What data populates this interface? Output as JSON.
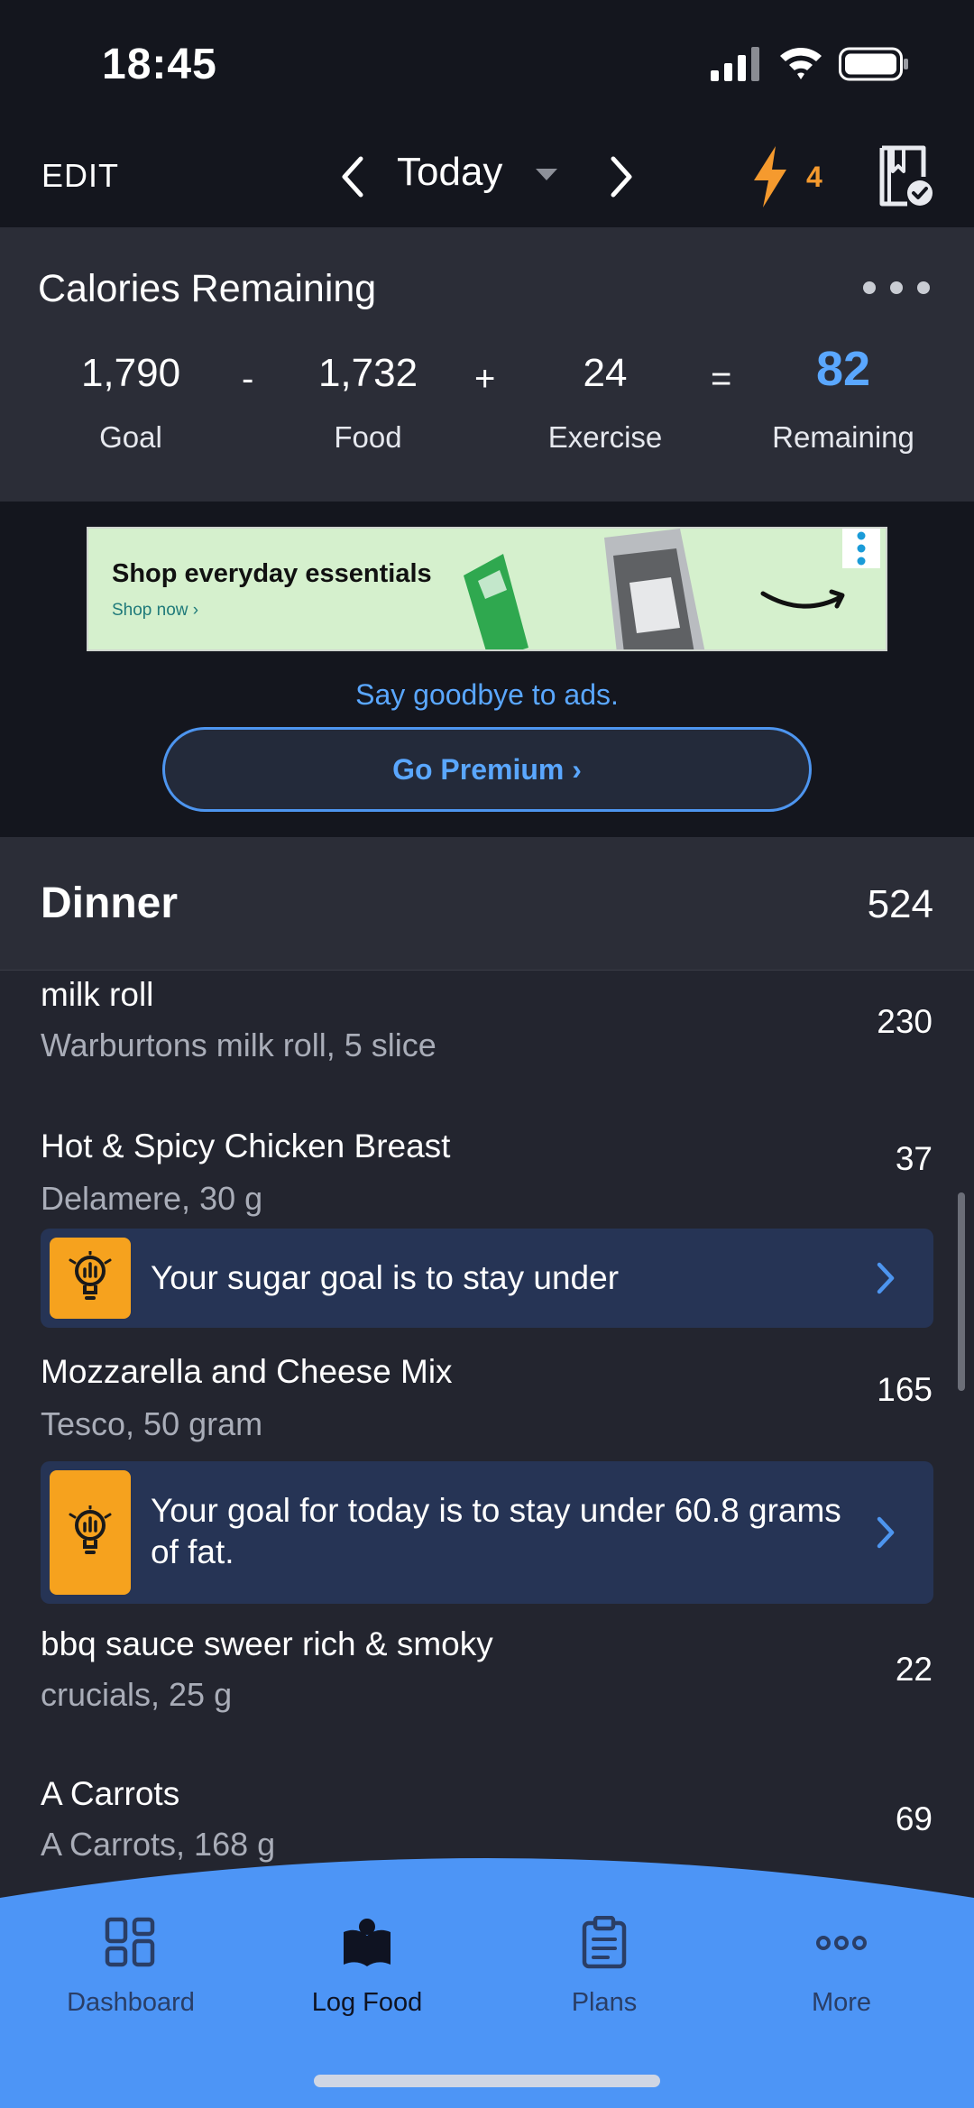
{
  "status_bar": {
    "time": "18:45",
    "icons": [
      "cellular-signal-icon",
      "wifi-icon",
      "battery-icon"
    ]
  },
  "top_nav": {
    "edit_label": "EDIT",
    "date_label": "Today",
    "streak_count": "4",
    "icons": [
      "chevron-left-icon",
      "caret-down-icon",
      "chevron-right-icon",
      "lightning-icon",
      "diary-complete-icon"
    ]
  },
  "calories": {
    "title": "Calories Remaining",
    "goal": {
      "value": "1,790",
      "label": "Goal"
    },
    "op_minus": "-",
    "food": {
      "value": "1,732",
      "label": "Food"
    },
    "op_plus": "+",
    "exercise": {
      "value": "24",
      "label": "Exercise"
    },
    "op_equals": "=",
    "remaining": {
      "value": "82",
      "label": "Remaining"
    }
  },
  "ad": {
    "title": "Shop everyday essentials",
    "cta": "Shop now ›",
    "goodbye_text": "Say goodbye to ads.",
    "premium_label": "Go Premium ›"
  },
  "meal": {
    "name": "Dinner",
    "calories": "524",
    "items": [
      {
        "name": "milk roll",
        "desc": "Warburtons milk roll, 5 slice",
        "cal": "230"
      },
      {
        "name": "Hot & Spicy Chicken Breast",
        "desc": "Delamere, 30 g",
        "cal": "37"
      },
      {
        "name": "Mozzarella and Cheese Mix",
        "desc": "Tesco, 50 gram",
        "cal": "165"
      },
      {
        "name": "bbq sauce sweer rich & smoky",
        "desc": "crucials, 25 g",
        "cal": "22"
      },
      {
        "name": "A Carrots",
        "desc": "A Carrots, 168 g",
        "cal": "69"
      }
    ],
    "tips": [
      {
        "text": "Your sugar goal is to stay under"
      },
      {
        "text": "Your goal for today is to stay under 60.8 grams of fat."
      }
    ]
  },
  "bottom_nav": {
    "tabs": [
      {
        "label": "Dashboard",
        "icon": "dashboard-grid-icon"
      },
      {
        "label": "Log Food",
        "icon": "log-food-book-icon",
        "active": true
      },
      {
        "label": "Plans",
        "icon": "clipboard-icon"
      },
      {
        "label": "More",
        "icon": "more-dots-icon"
      }
    ]
  },
  "colors": {
    "accent": "#5aa7ff",
    "streak": "#f59a2e",
    "tip_icon": "#f6a21e",
    "bottom_nav": "#4d95f6"
  }
}
